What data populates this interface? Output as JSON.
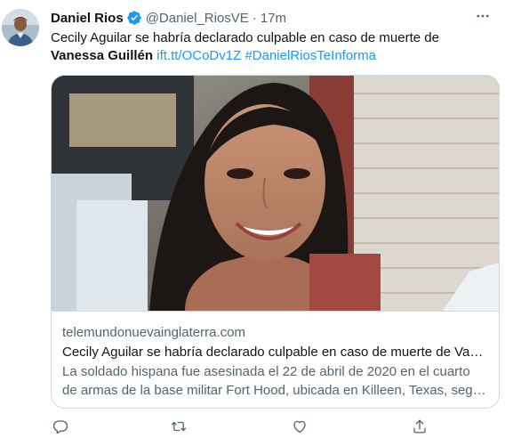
{
  "user": {
    "display_name": "Daniel Rios",
    "handle": "@Daniel_RiosVE",
    "separator": "·",
    "time": "17m"
  },
  "tweet": {
    "text_part1": "Cecily Aguilar se habría declarado culpable en caso de muerte de ",
    "text_bold": "Vanessa Guillén",
    "link": "ift.tt/OCoDv1Z",
    "hashtag": "#DanielRiosTeInforma"
  },
  "card": {
    "domain": "telemundonuevainglaterra.com",
    "title": "Cecily Aguilar se habría declarado culpable en caso de muerte de Vanessa Guillén",
    "description": "La soldado hispana fue asesinada el 22 de abril de 2020 en el cuarto de armas de la base militar Fort Hood, ubicada en Killeen, Texas, según las autoridades."
  },
  "icons": {
    "verified": "verified-badge-icon",
    "more": "more-options-icon",
    "reply": "reply-icon",
    "retweet": "retweet-icon",
    "like": "like-icon",
    "share": "share-icon"
  },
  "colors": {
    "accent": "#1d9bf0",
    "text": "#0f1419",
    "secondary_text": "#536471",
    "border": "#cfd9de"
  }
}
